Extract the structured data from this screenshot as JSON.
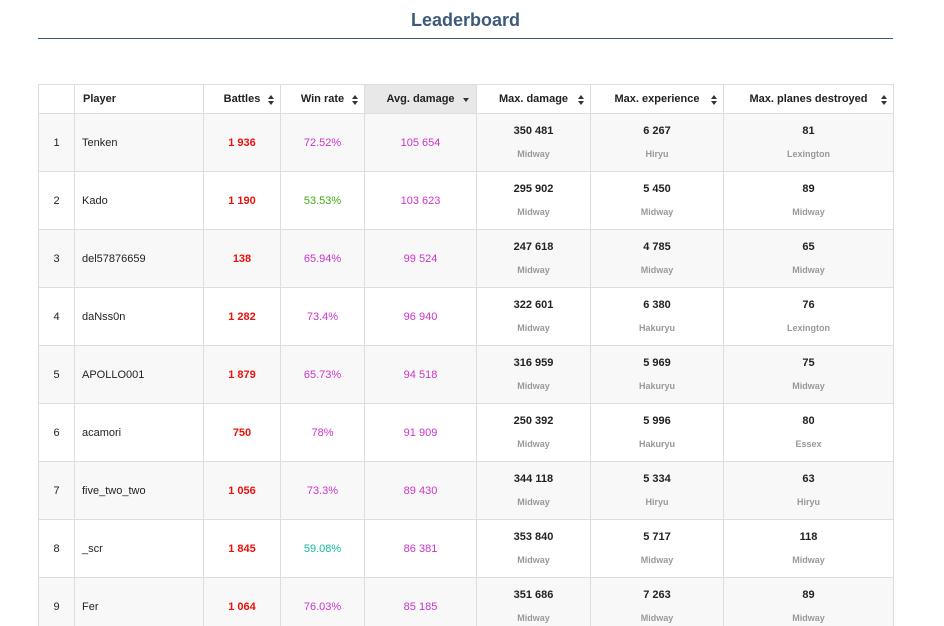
{
  "page": {
    "title": "Leaderboard"
  },
  "table": {
    "headers": {
      "rank": "",
      "player": "Player",
      "battles": "Battles",
      "win_rate": "Win rate",
      "avg_damage": "Avg. damage",
      "max_damage": "Max. damage",
      "max_experience": "Max. experience",
      "max_planes": "Max. planes destroyed"
    },
    "sorted_column": "avg_damage",
    "colors": {
      "battles": "#e8120d",
      "win_purple": "#cc33cc",
      "win_green": "#44aa11",
      "win_teal": "#11bb99",
      "avg_damage": "#cc33cc",
      "title": "#3d5a7a"
    },
    "rows": [
      {
        "rank": "1",
        "player": "Tenken",
        "battles": "1 936",
        "win_rate": "72.52%",
        "win_color": "#cc33cc",
        "avg_damage": "105 654",
        "max_damage": "350 481",
        "max_damage_ship": "Midway",
        "max_exp": "6 267",
        "max_exp_ship": "Hiryu",
        "max_planes": "81",
        "max_planes_ship": "Lexington"
      },
      {
        "rank": "2",
        "player": "Kado",
        "battles": "1 190",
        "win_rate": "53.53%",
        "win_color": "#44aa11",
        "avg_damage": "103 623",
        "max_damage": "295 902",
        "max_damage_ship": "Midway",
        "max_exp": "5 450",
        "max_exp_ship": "Midway",
        "max_planes": "89",
        "max_planes_ship": "Midway"
      },
      {
        "rank": "3",
        "player": "del57876659",
        "battles": "138",
        "win_rate": "65.94%",
        "win_color": "#cc33cc",
        "avg_damage": "99 524",
        "max_damage": "247 618",
        "max_damage_ship": "Midway",
        "max_exp": "4 785",
        "max_exp_ship": "Midway",
        "max_planes": "65",
        "max_planes_ship": "Midway"
      },
      {
        "rank": "4",
        "player": "daNss0n",
        "battles": "1 282",
        "win_rate": "73.4%",
        "win_color": "#cc33cc",
        "avg_damage": "96 940",
        "max_damage": "322 601",
        "max_damage_ship": "Midway",
        "max_exp": "6 380",
        "max_exp_ship": "Hakuryu",
        "max_planes": "76",
        "max_planes_ship": "Lexington"
      },
      {
        "rank": "5",
        "player": "APOLLO001",
        "battles": "1 879",
        "win_rate": "65.73%",
        "win_color": "#cc33cc",
        "avg_damage": "94 518",
        "max_damage": "316 959",
        "max_damage_ship": "Midway",
        "max_exp": "5 969",
        "max_exp_ship": "Hakuryu",
        "max_planes": "75",
        "max_planes_ship": "Midway"
      },
      {
        "rank": "6",
        "player": "acamori",
        "battles": "750",
        "win_rate": "78%",
        "win_color": "#cc33cc",
        "avg_damage": "91 909",
        "max_damage": "250 392",
        "max_damage_ship": "Midway",
        "max_exp": "5 996",
        "max_exp_ship": "Hakuryu",
        "max_planes": "80",
        "max_planes_ship": "Essex"
      },
      {
        "rank": "7",
        "player": "five_two_two",
        "battles": "1 056",
        "win_rate": "73.3%",
        "win_color": "#cc33cc",
        "avg_damage": "89 430",
        "max_damage": "344 118",
        "max_damage_ship": "Midway",
        "max_exp": "5 334",
        "max_exp_ship": "Hiryu",
        "max_planes": "63",
        "max_planes_ship": "Hiryu"
      },
      {
        "rank": "8",
        "player": "_scr",
        "battles": "1 845",
        "win_rate": "59.08%",
        "win_color": "#11bb99",
        "avg_damage": "86 381",
        "max_damage": "353 840",
        "max_damage_ship": "Midway",
        "max_exp": "5 717",
        "max_exp_ship": "Midway",
        "max_planes": "118",
        "max_planes_ship": "Midway"
      },
      {
        "rank": "9",
        "player": "Fer",
        "battles": "1 064",
        "win_rate": "76.03%",
        "win_color": "#cc33cc",
        "avg_damage": "85 185",
        "max_damage": "351 686",
        "max_damage_ship": "Midway",
        "max_exp": "7 263",
        "max_exp_ship": "Midway",
        "max_planes": "89",
        "max_planes_ship": "Midway"
      }
    ]
  }
}
